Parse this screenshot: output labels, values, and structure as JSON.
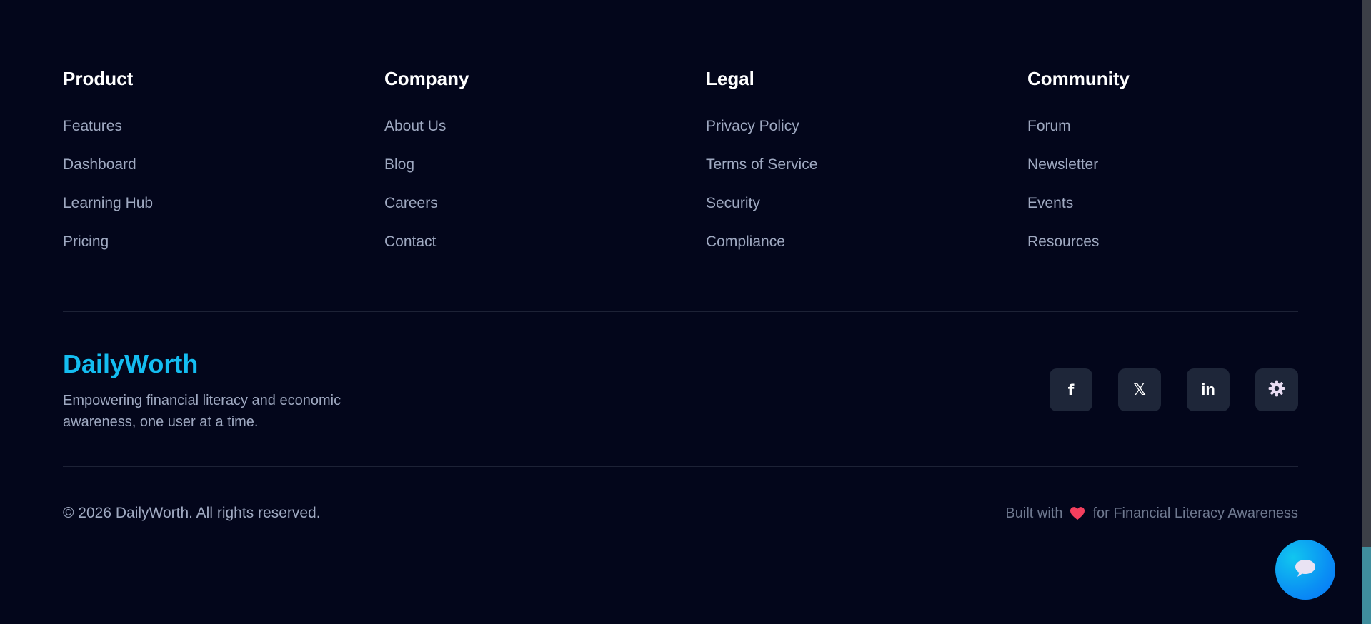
{
  "footer": {
    "columns": [
      {
        "title": "Product",
        "links": [
          "Features",
          "Dashboard",
          "Learning Hub",
          "Pricing"
        ]
      },
      {
        "title": "Company",
        "links": [
          "About Us",
          "Blog",
          "Careers",
          "Contact"
        ]
      },
      {
        "title": "Legal",
        "links": [
          "Privacy Policy",
          "Terms of Service",
          "Security",
          "Compliance"
        ]
      },
      {
        "title": "Community",
        "links": [
          "Forum",
          "Newsletter",
          "Events",
          "Resources"
        ]
      }
    ],
    "brand": {
      "name": "DailyWorth",
      "tagline": "Empowering financial literacy and economic awareness, one user at a time."
    },
    "social": [
      {
        "icon": "facebook-icon",
        "glyph": "f"
      },
      {
        "icon": "x-twitter-icon",
        "glyph": "𝕏"
      },
      {
        "icon": "linkedin-icon",
        "glyph": "in"
      },
      {
        "icon": "gear-icon"
      }
    ],
    "copyright": "© 2026 DailyWorth. All rights reserved.",
    "built_with": {
      "before": "Built with",
      "after": "for Financial Literacy Awareness",
      "icon": "heart-icon"
    }
  },
  "chat_button": {
    "icon": "chat-bubble-icon"
  },
  "colors": {
    "background": "#03061b",
    "brand": "#14bdf1",
    "link": "#9fa9c1",
    "heading": "#ffffff",
    "social_bg": "#1e2639",
    "heart": "#f43f5e",
    "chat_gradient_start": "#11c6ef",
    "chat_gradient_end": "#0672f8"
  }
}
